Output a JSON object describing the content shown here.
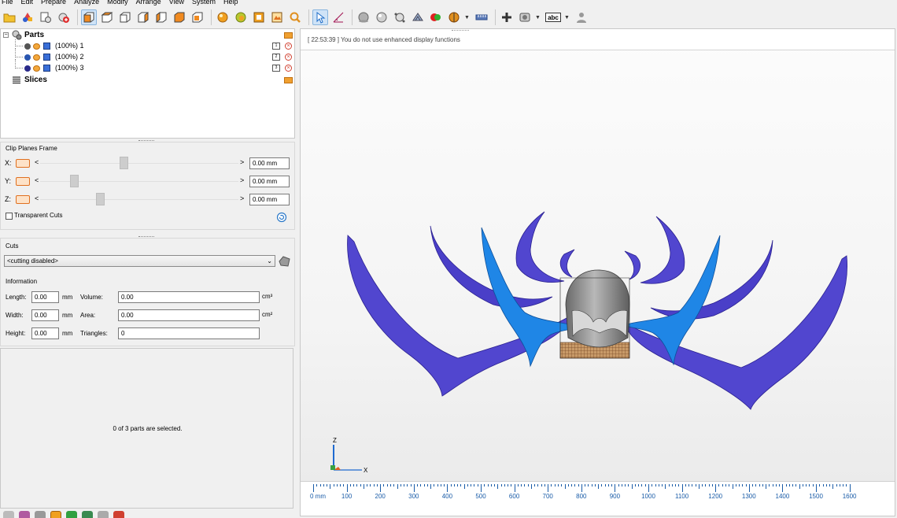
{
  "menu": [
    "File",
    "Edit",
    "Prepare",
    "Analyze",
    "Modify",
    "Arrange",
    "View",
    "System",
    "Help"
  ],
  "toolbar": {
    "icons": [
      "open-file-icon",
      "import-part-icon",
      "part-properties-icon",
      "add-part-icon",
      "view-front-icon",
      "view-back-icon",
      "view-left-icon",
      "view-right-icon",
      "view-top-icon",
      "view-bottom-icon",
      "shading-icon",
      "wireframe-icon",
      "view-all-icon",
      "zoom-icon",
      "select-icon",
      "measure-icon",
      "sphere-icon",
      "sphere-outline-icon",
      "points-icon",
      "mesh-icon",
      "color-icon",
      "section-icon",
      "ruler-icon",
      "add-icon",
      "snapshot-icon",
      "label-icon",
      "user-icon"
    ],
    "label_icon_text": "abc"
  },
  "tree": {
    "parts_label": "Parts",
    "items": [
      {
        "label": "(100%) 1",
        "box": "1",
        "color": "#444444"
      },
      {
        "label": "(100%) 2",
        "box": "2",
        "color": "#3a6fd8"
      },
      {
        "label": "(100%) 3",
        "box": "3",
        "color": "#2a2a8a"
      }
    ],
    "slices_label": "Slices"
  },
  "clip": {
    "title": "Clip Planes Frame",
    "rows": [
      {
        "axis": "X:",
        "value": "0.00 mm",
        "thumb": 0.42
      },
      {
        "axis": "Y:",
        "value": "0.00 mm",
        "thumb": 0.17
      },
      {
        "axis": "Z:",
        "value": "0.00 mm",
        "thumb": 0.3
      }
    ],
    "lt": "<",
    "gt": ">",
    "transparent_label": "Transparent Cuts"
  },
  "cuts": {
    "title": "Cuts",
    "selected": "<cutting disabled>",
    "info_title": "Information",
    "length_label": "Length:",
    "length_value": "0.00",
    "length_unit": "mm",
    "width_label": "Width:",
    "width_value": "0.00",
    "width_unit": "mm",
    "height_label": "Height:",
    "height_value": "0.00",
    "height_unit": "mm",
    "volume_label": "Volume:",
    "volume_value": "0.00",
    "volume_unit": "cm³",
    "area_label": "Area:",
    "area_value": "0.00",
    "area_unit": "cm²",
    "triangles_label": "Triangles:",
    "triangles_value": "0"
  },
  "selection": {
    "message": "0 of 3 parts are selected."
  },
  "viewport": {
    "log": "[ 22:53:39 ] You do not use enhanced display functions",
    "axis_z": "Z",
    "axis_x": "X",
    "ruler_labels": [
      "0 mm",
      "100",
      "200",
      "300",
      "400",
      "500",
      "600",
      "700",
      "800",
      "900",
      "1000",
      "1100",
      "1200",
      "1300",
      "1400",
      "1500",
      "1600"
    ]
  },
  "colors": {
    "horn_dark": "#5146cf",
    "horn_light": "#1f86e6",
    "helmet": "#8a8a8a",
    "ruler": "#1a5ca8"
  }
}
